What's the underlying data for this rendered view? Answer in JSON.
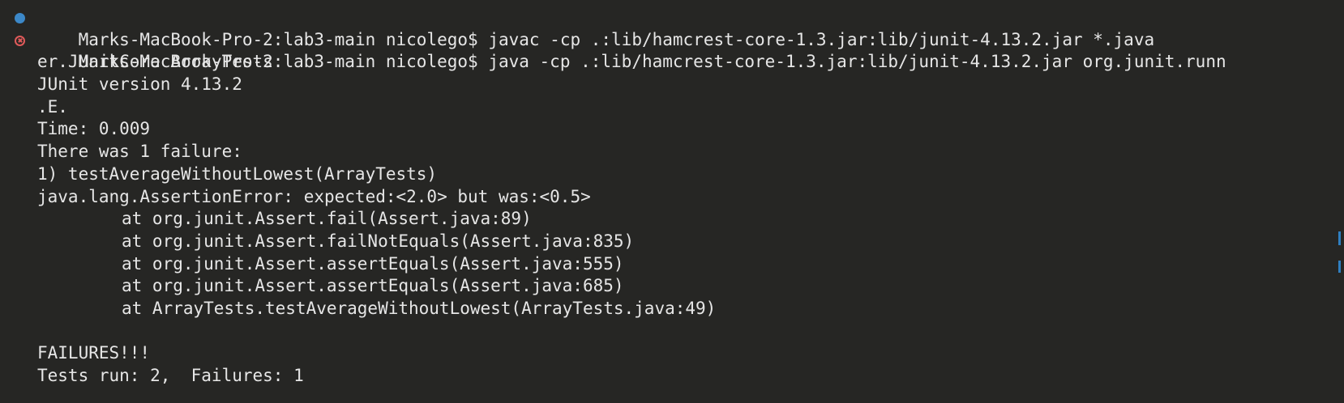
{
  "terminal": {
    "lines": [
      {
        "type": "command",
        "status": "success",
        "prompt": "Marks-MacBook-Pro-2:lab3-main nicolego$ ",
        "text": "javac -cp .:lib/hamcrest-core-1.3.jar:lib/junit-4.13.2.jar *.java"
      },
      {
        "type": "command",
        "status": "error",
        "prompt": "Marks-MacBook-Pro-2:lab3-main nicolego$ ",
        "text": "java -cp .:lib/hamcrest-core-1.3.jar:lib/junit-4.13.2.jar org.junit.runn"
      },
      {
        "type": "output",
        "text": "er.JUnitCore ArrayTests"
      },
      {
        "type": "output",
        "text": "JUnit version 4.13.2"
      },
      {
        "type": "output",
        "text": ".E."
      },
      {
        "type": "output",
        "text": "Time: 0.009"
      },
      {
        "type": "output",
        "text": "There was 1 failure:"
      },
      {
        "type": "output",
        "text": "1) testAverageWithoutLowest(ArrayTests)"
      },
      {
        "type": "output",
        "text": "java.lang.AssertionError: expected:<2.0> but was:<0.5>"
      },
      {
        "type": "trace",
        "text": "at org.junit.Assert.fail(Assert.java:89)"
      },
      {
        "type": "trace",
        "text": "at org.junit.Assert.failNotEquals(Assert.java:835)"
      },
      {
        "type": "trace",
        "text": "at org.junit.Assert.assertEquals(Assert.java:555)"
      },
      {
        "type": "trace",
        "text": "at org.junit.Assert.assertEquals(Assert.java:685)"
      },
      {
        "type": "trace",
        "text": "at ArrayTests.testAverageWithoutLowest(ArrayTests.java:49)"
      },
      {
        "type": "output",
        "text": ""
      },
      {
        "type": "output",
        "text": "FAILURES!!!"
      },
      {
        "type": "output",
        "text": "Tests run: 2,  Failures: 1"
      }
    ]
  },
  "colors": {
    "background": "#262624",
    "text": "#e6e6e6",
    "success_marker": "#3c88c8",
    "error_marker": "#e05a5a",
    "scroll_marker": "#2f7fc1"
  }
}
